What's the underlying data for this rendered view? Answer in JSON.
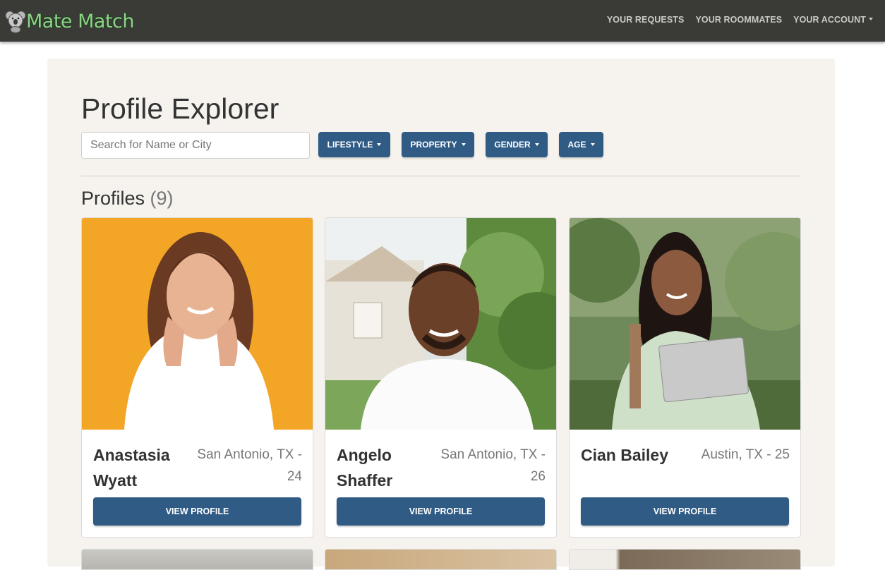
{
  "navbar": {
    "brand": "Mate Match",
    "links": [
      {
        "label": "YOUR REQUESTS"
      },
      {
        "label": "YOUR ROOMMATES"
      },
      {
        "label": "YOUR ACCOUNT"
      }
    ]
  },
  "page": {
    "title": "Profile Explorer",
    "search_placeholder": "Search for Name or City",
    "filters": [
      "LIFESTYLE",
      "PROPERTY",
      "GENDER",
      "AGE"
    ],
    "profiles_label": "Profiles",
    "profiles_count": "(9)"
  },
  "profiles": [
    {
      "name": "Anastasia Wyatt",
      "meta": "San Antonio, TX - 24",
      "button": "VIEW PROFILE"
    },
    {
      "name": "Angelo Shaffer",
      "meta": "San Antonio, TX - 26",
      "button": "VIEW PROFILE"
    },
    {
      "name": "Cian Bailey",
      "meta": "Austin, TX - 25",
      "button": "VIEW PROFILE"
    }
  ],
  "colors": {
    "navbar": "#3a3b37",
    "brand_green": "#8fd28a",
    "panel": "#f6f3ef",
    "primary": "#2f5b85"
  }
}
